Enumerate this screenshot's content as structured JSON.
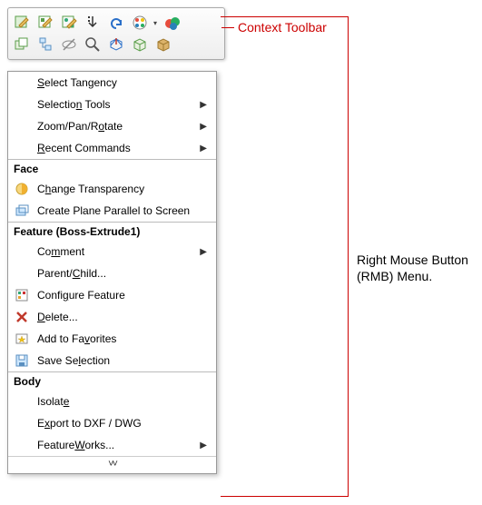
{
  "annotations": {
    "context_toolbar": "Context Toolbar",
    "rmb_line1": "Right Mouse Button",
    "rmb_line2": "(RMB) Menu."
  },
  "toolbar": {
    "row1": [
      "edit-feature",
      "edit-sketch",
      "sketch-properties",
      "move-down",
      "undo",
      "appearance",
      "appearance-dropdown",
      "render-tools"
    ],
    "row2": [
      "copy-entity",
      "parent-child",
      "hide",
      "zoom-to",
      "normal-to",
      "box-select",
      "view-cube"
    ]
  },
  "menu": {
    "top": [
      {
        "key": "select-tangency",
        "pre": "",
        "u": "S",
        "post": "elect Tangency",
        "sub": false
      },
      {
        "key": "selection-tools",
        "pre": "Selectio",
        "u": "n",
        "post": " Tools",
        "sub": true
      },
      {
        "key": "zoom-pan-rotate",
        "pre": "Zoom/Pan/R",
        "u": "o",
        "post": "tate",
        "sub": true
      },
      {
        "key": "recent-commands",
        "pre": "",
        "u": "R",
        "post": "ecent Commands",
        "sub": true
      }
    ],
    "sec_face": "Face",
    "face": [
      {
        "key": "change-transparency",
        "icon": "transparency",
        "pre": "C",
        "u": "h",
        "post": "ange Transparency",
        "sub": false
      },
      {
        "key": "create-plane-parallel",
        "icon": "plane",
        "pre": "Create Plane Parallel to Screen",
        "u": "",
        "post": "",
        "sub": false
      }
    ],
    "sec_feature": "Feature (Boss-Extrude1)",
    "feature": [
      {
        "key": "comment",
        "icon": "",
        "pre": "Co",
        "u": "m",
        "post": "ment",
        "sub": true
      },
      {
        "key": "parent-child",
        "icon": "",
        "pre": "Parent/",
        "u": "C",
        "post": "hild...",
        "sub": false
      },
      {
        "key": "configure-feature",
        "icon": "config",
        "pre": "Confi",
        "u": "g",
        "post": "ure Feature",
        "sub": false
      },
      {
        "key": "delete",
        "icon": "delete",
        "pre": "",
        "u": "D",
        "post": "elete...",
        "sub": false
      },
      {
        "key": "add-to-favorites",
        "icon": "favorite",
        "pre": "Add to Fa",
        "u": "v",
        "post": "orites",
        "sub": false
      },
      {
        "key": "save-selection",
        "icon": "save",
        "pre": "Save Se",
        "u": "l",
        "post": "ection",
        "sub": false
      }
    ],
    "sec_body": "Body",
    "body": [
      {
        "key": "isolate",
        "icon": "",
        "pre": "Isolat",
        "u": "e",
        "post": "",
        "sub": false
      },
      {
        "key": "export-dxf",
        "icon": "",
        "pre": "E",
        "u": "x",
        "post": "port to DXF / DWG",
        "sub": false
      },
      {
        "key": "featureworks",
        "icon": "",
        "pre": "Feature",
        "u": "W",
        "post": "orks...",
        "sub": true
      }
    ]
  }
}
